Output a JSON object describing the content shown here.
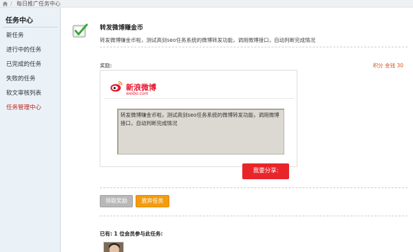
{
  "topbar": {
    "title": "每日推广任务中心"
  },
  "sidebar": {
    "title": "任务中心",
    "items": [
      {
        "label": "新任务"
      },
      {
        "label": "进行中的任务"
      },
      {
        "label": "已完成的任务"
      },
      {
        "label": "失败的任务"
      },
      {
        "label": "软文审核列表"
      },
      {
        "label": "任务管理中心"
      }
    ],
    "active_color": "#c0221c"
  },
  "task": {
    "title": "转发微博赚金币",
    "description": "转发微博赚金币啦，测试高剑seo任务系统的微博转发功能，调用微博接口，自动判断完成情况",
    "reward_label": "奖励:",
    "reward_value": "积分 金钱 30"
  },
  "weibo": {
    "name": "新浪微博",
    "domain": "weibo.com",
    "share_text": "转发微博赚金币啦，测试高剑seo任务系统的微博转发功能，调用微博接口，自动判断完成情况"
  },
  "buttons": {
    "share": "我要分享:",
    "claim": "领取奖励",
    "abandon": "放弃任务"
  },
  "participants": {
    "label": "已有: 1 位会员参与此任务:"
  },
  "colors": {
    "accent_red": "#e8262a",
    "orange": "#f39c12",
    "reward": "#d9531e"
  }
}
